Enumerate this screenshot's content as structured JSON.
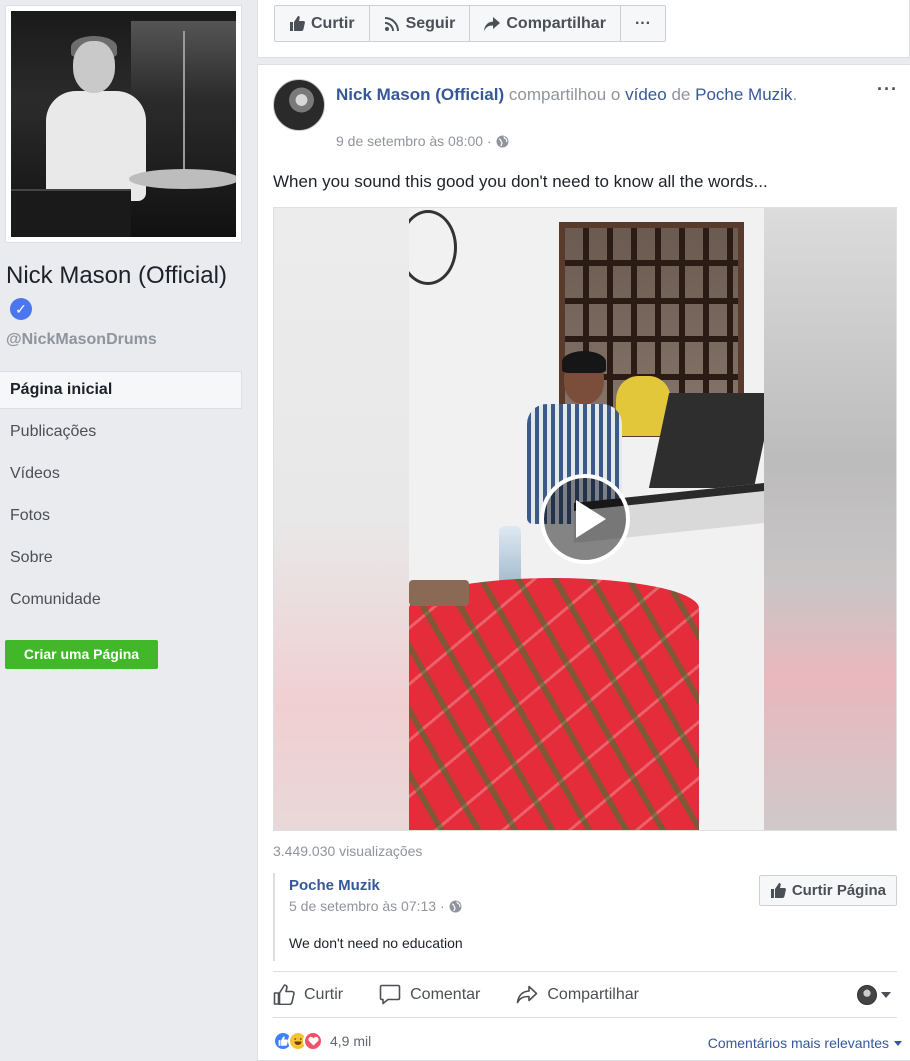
{
  "sidebar": {
    "page_name": "Nick Mason (Official)",
    "handle": "@NickMasonDrums",
    "nav": [
      "Página inicial",
      "Publicações",
      "Vídeos",
      "Fotos",
      "Sobre",
      "Comunidade"
    ],
    "create_page": "Criar uma Página"
  },
  "toolbar": {
    "like": "Curtir",
    "follow": "Seguir",
    "share": "Compartilhar",
    "more": "···"
  },
  "post": {
    "author": "Nick Mason (Official)",
    "shared": "compartilhou o",
    "video_link": "vídeo",
    "of": "de",
    "source": "Poche Muzik",
    "period": ".",
    "time": "9 de setembro às 08:00",
    "separator": "·",
    "more": "···",
    "text": "When you sound this good you don't need to know all the words...",
    "views": "3.449.030 visualizações"
  },
  "shared_box": {
    "name": "Poche Muzik",
    "time": "5 de setembro às 07:13",
    "separator": "·",
    "text": "We don't need no education",
    "like_page": "Curtir Página"
  },
  "actions": {
    "like": "Curtir",
    "comment": "Comentar",
    "share": "Compartilhar"
  },
  "reactions": {
    "count": "4,9 mil",
    "sort": "Comentários mais relevantes"
  },
  "colors": {
    "link": "#365899",
    "create_button": "#42b72a",
    "verified": "#4a76f0"
  }
}
